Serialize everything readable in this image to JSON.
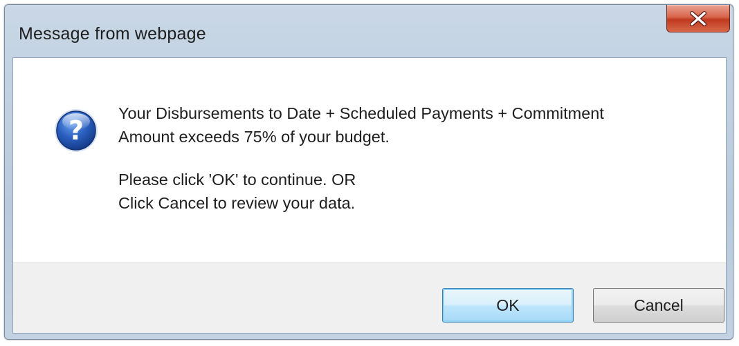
{
  "dialog": {
    "title": "Message from webpage",
    "close_symbol": "X",
    "icon": "question-icon",
    "message_lines": [
      "Your Disbursements to Date + Scheduled Payments + Commitment",
      "Amount exceeds 75% of your budget.",
      "Please click 'OK' to continue. OR",
      "Click Cancel to review your data."
    ],
    "buttons": {
      "ok_label": "OK",
      "cancel_label": "Cancel"
    }
  },
  "colors": {
    "titlebar": "#c3d2e2",
    "close_button": "#c0391f",
    "icon_blue": "#1f4fa8",
    "default_button_border": "#3c7fb1"
  }
}
